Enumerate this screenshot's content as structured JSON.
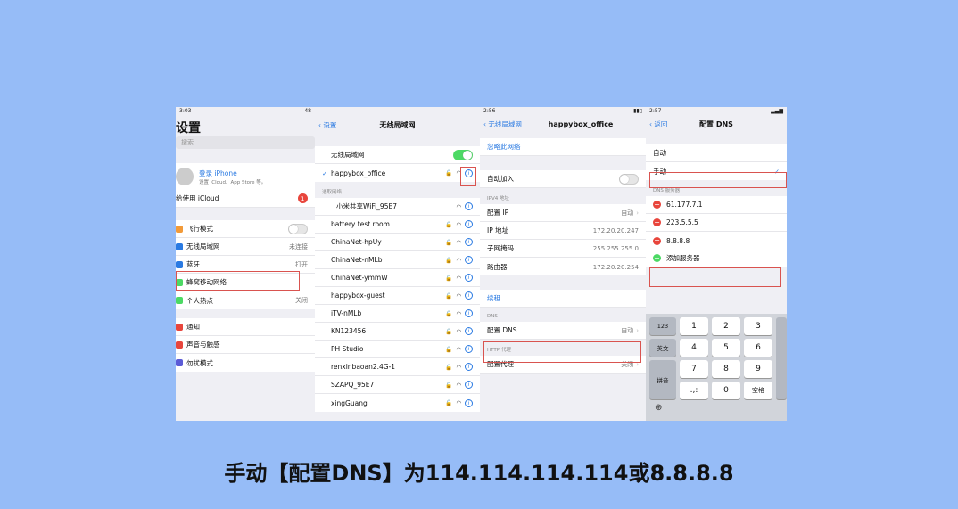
{
  "colors": {
    "background": "#96bcf7",
    "accent_blue": "#2a7ae2",
    "highlight_red": "#d9534f",
    "toggle_green": "#4cd964",
    "delete_red": "#e8453c"
  },
  "panel1": {
    "status_time": "3:03",
    "status_right": "48",
    "title": "设置",
    "search_placeholder": "搜索",
    "profile": {
      "name": "登录 iPhone",
      "sub": "设置 iCloud、App Store 等。"
    },
    "icloud": "给使用 iCloud",
    "icloud_badge": "1",
    "items": [
      {
        "label": "飞行模式",
        "value": "",
        "color": "#f29a38"
      },
      {
        "label": "无线局域网",
        "value": "未连接",
        "color": "#2a7ae2"
      },
      {
        "label": "蓝牙",
        "value": "打开",
        "color": "#2a7ae2"
      },
      {
        "label": "蜂窝移动网络",
        "value": "",
        "color": "#4cd964"
      },
      {
        "label": "个人热点",
        "value": "关闭",
        "color": "#4cd964"
      }
    ],
    "items2": [
      {
        "label": "通知",
        "color": "#e8453c"
      },
      {
        "label": "声音与触感",
        "color": "#e8453c"
      },
      {
        "label": "勿扰模式",
        "color": "#5b5bd6"
      }
    ]
  },
  "panel2": {
    "back": "设置",
    "title": "无线局域网",
    "wifi_label": "无线局域网",
    "connected": "happybox_office",
    "choose_header": "选取网络...",
    "networks": [
      "小米共享WiFi_95E7",
      "battery test room",
      "ChinaNet-hpUy",
      "ChinaNet-nMLb",
      "ChinaNet-ymmW",
      "happybox-guest",
      "iTV-nMLb",
      "KN123456",
      "PH Studio",
      "renxinbaoan2.4G-1",
      "SZAPQ_95E7",
      "xingGuang"
    ]
  },
  "panel3": {
    "status_time": "2:56",
    "back": "无线局域网",
    "title": "happybox_office",
    "forget": "忽略此网络",
    "auto_join": "自动加入",
    "ipv4_header": "IPV4 地址",
    "rows": [
      {
        "label": "配置 IP",
        "value": "自动"
      },
      {
        "label": "IP 地址",
        "value": "172.20.20.247"
      },
      {
        "label": "子网掩码",
        "value": "255.255.255.0"
      },
      {
        "label": "路由器",
        "value": "172.20.20.254"
      }
    ],
    "renew": "续租",
    "dns_header": "DNS",
    "dns_label": "配置 DNS",
    "dns_value": "自动",
    "proxy_header": "HTTP 代理",
    "proxy_label": "配置代理",
    "proxy_value": "关闭"
  },
  "panel4": {
    "status_time": "2:57",
    "back": "返回",
    "title": "配置 DNS",
    "auto": "自动",
    "manual": "手动",
    "servers_header": "DNS 服务器",
    "servers": [
      "61.177.7.1",
      "223.5.5.5",
      "8.8.8.8"
    ],
    "add": "添加服务器",
    "keys": {
      "k123": "123",
      "kEn": "英文",
      "kPinyin": "拼音",
      "kSpace": "空格",
      "kPunct": ".,:",
      "n1": "1",
      "n2": "2",
      "n3": "3",
      "n4": "4",
      "n5": "5",
      "n6": "6",
      "n7": "7",
      "n8": "8",
      "n9": "9",
      "n0": "0"
    }
  },
  "caption": "手动【配置DNS】为114.114.114.114或8.8.8.8"
}
